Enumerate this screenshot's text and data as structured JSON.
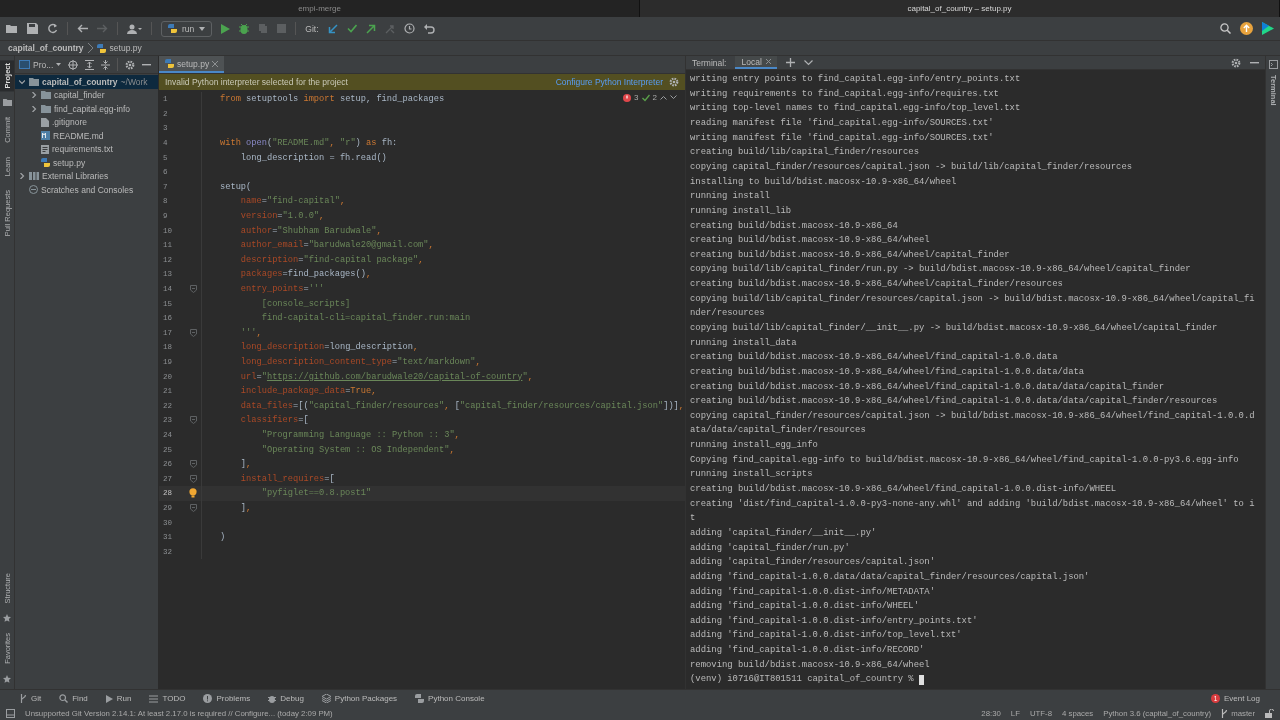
{
  "title_bar": {
    "tabs": [
      {
        "title": "empi-merge",
        "selected": false
      },
      {
        "title": "capital_of_country – setup.py",
        "selected": true
      }
    ]
  },
  "toolbar": {
    "left": [
      {
        "kind": "open",
        "disabled": false
      },
      {
        "kind": "save",
        "disabled": false
      },
      {
        "kind": "sync",
        "disabled": false
      },
      {
        "kind": "back",
        "disabled": false
      },
      {
        "kind": "forward",
        "disabled": true
      },
      {
        "kind": "user",
        "disabled": false
      }
    ],
    "run_config": "run",
    "run_actions": [
      {
        "kind": "play",
        "disabled": false
      },
      {
        "kind": "debug",
        "disabled": false
      },
      {
        "kind": "coverage",
        "disabled": true
      },
      {
        "kind": "stop",
        "disabled": true
      }
    ],
    "git_label": "Git:",
    "git_actions": [
      {
        "kind": "update",
        "disabled": false
      },
      {
        "kind": "commit",
        "disabled": false
      },
      {
        "kind": "push",
        "disabled": false
      },
      {
        "kind": "merge",
        "disabled": true
      },
      {
        "kind": "history",
        "disabled": false
      },
      {
        "kind": "rollback",
        "disabled": false
      }
    ]
  },
  "breadcrumb": [
    "capital_of_country",
    "setup.py"
  ],
  "left_strip": {
    "top": [
      {
        "label": "Project",
        "selected": true
      },
      {
        "label": "Commit",
        "selected": false
      },
      {
        "label": "Learn",
        "selected": false
      },
      {
        "label": "Pull Requests",
        "selected": false
      }
    ],
    "bottom": [
      {
        "label": "Structure",
        "selected": false
      },
      {
        "label": "Favorites",
        "selected": false
      }
    ]
  },
  "project": {
    "title": "Pro...",
    "tree": [
      {
        "name": "capital_of_country",
        "note": "~/Work",
        "kind": "folder",
        "expanded": true,
        "selected": true,
        "children": [
          {
            "name": "capital_finder",
            "kind": "folder",
            "expanded": false,
            "selected": false
          },
          {
            "name": "find_capital.egg-info",
            "kind": "folder",
            "expanded": false,
            "selected": false
          },
          {
            "name": ".gitignore",
            "kind": "file",
            "selected": false
          },
          {
            "name": "README.md",
            "kind": "markdown",
            "selected": false
          },
          {
            "name": "requirements.txt",
            "kind": "text",
            "selected": false
          },
          {
            "name": "setup.py",
            "kind": "python",
            "selected": false
          }
        ]
      },
      {
        "name": "External Libraries",
        "kind": "library",
        "expanded": false,
        "selected": false
      },
      {
        "name": "Scratches and Consoles",
        "kind": "scratch",
        "selected": false
      }
    ]
  },
  "editor": {
    "tab": "setup.py",
    "banner": {
      "message": "Invalid Python interpreter selected for the project",
      "link": "Configure Python Interpreter"
    },
    "errors": "3",
    "warnings": "2",
    "lines": [
      {
        "number": "1",
        "tokens": [
          {
            "kind": "kw",
            "text": "from"
          },
          {
            "kind": "plain",
            "text": " setuptools "
          },
          {
            "kind": "kw",
            "text": "import"
          },
          {
            "kind": "plain",
            "text": " setup, find_packages"
          }
        ]
      },
      {
        "number": "2"
      },
      {
        "number": "3"
      },
      {
        "number": "4",
        "tokens": [
          {
            "kind": "kw",
            "text": "with "
          },
          {
            "kind": "builtin",
            "text": "open"
          },
          {
            "kind": "plain",
            "text": "("
          },
          {
            "kind": "str",
            "text": "\"README.md\""
          },
          {
            "kind": "kw",
            "text": ", "
          },
          {
            "kind": "str",
            "text": "\"r\""
          },
          {
            "kind": "plain",
            "text": ") "
          },
          {
            "kind": "kw",
            "text": "as"
          },
          {
            "kind": "plain",
            "text": " fh:"
          }
        ]
      },
      {
        "number": "5",
        "tokens": [
          {
            "kind": "plain",
            "text": "    long_description = fh.read()"
          }
        ]
      },
      {
        "number": "6"
      },
      {
        "number": "7",
        "tokens": [
          {
            "kind": "plain",
            "text": "setup("
          }
        ]
      },
      {
        "number": "8",
        "tokens": [
          {
            "kind": "param",
            "text": "    name"
          },
          {
            "kind": "plain",
            "text": "="
          },
          {
            "kind": "str",
            "text": "\"find-capital\""
          },
          {
            "kind": "kw",
            "text": ","
          }
        ]
      },
      {
        "number": "9",
        "tokens": [
          {
            "kind": "param",
            "text": "    version"
          },
          {
            "kind": "plain",
            "text": "="
          },
          {
            "kind": "str",
            "text": "\"1.0.0\""
          },
          {
            "kind": "kw",
            "text": ","
          }
        ]
      },
      {
        "number": "10",
        "tokens": [
          {
            "kind": "param",
            "text": "    author"
          },
          {
            "kind": "plain",
            "text": "="
          },
          {
            "kind": "str",
            "text": "\"Shubham Barudwale\""
          },
          {
            "kind": "kw",
            "text": ","
          }
        ]
      },
      {
        "number": "11",
        "tokens": [
          {
            "kind": "param",
            "text": "    author_email"
          },
          {
            "kind": "plain",
            "text": "="
          },
          {
            "kind": "str",
            "text": "\"barudwale20@gmail.com\""
          },
          {
            "kind": "kw",
            "text": ","
          }
        ]
      },
      {
        "number": "12",
        "tokens": [
          {
            "kind": "param",
            "text": "    description"
          },
          {
            "kind": "plain",
            "text": "="
          },
          {
            "kind": "str",
            "text": "\"find-capital package\""
          },
          {
            "kind": "kw",
            "text": ","
          }
        ]
      },
      {
        "number": "13",
        "tokens": [
          {
            "kind": "param",
            "text": "    packages"
          },
          {
            "kind": "plain",
            "text": "=find_packages()"
          },
          {
            "kind": "kw",
            "text": ","
          }
        ]
      },
      {
        "number": "14",
        "fold": true,
        "tokens": [
          {
            "kind": "param",
            "text": "    entry_points"
          },
          {
            "kind": "plain",
            "text": "="
          },
          {
            "kind": "str",
            "text": "'''"
          }
        ]
      },
      {
        "number": "15",
        "tokens": [
          {
            "kind": "str",
            "text": "        [console_scripts]"
          }
        ]
      },
      {
        "number": "16",
        "tokens": [
          {
            "kind": "str",
            "text": "        find-capital-cli=capital_finder.run:main"
          }
        ]
      },
      {
        "number": "17",
        "fold": true,
        "tokens": [
          {
            "kind": "str",
            "text": "    '''"
          },
          {
            "kind": "kw",
            "text": ","
          }
        ]
      },
      {
        "number": "18",
        "tokens": [
          {
            "kind": "param",
            "text": "    long_description"
          },
          {
            "kind": "plain",
            "text": "=long_description"
          },
          {
            "kind": "kw",
            "text": ","
          }
        ]
      },
      {
        "number": "19",
        "tokens": [
          {
            "kind": "param",
            "text": "    long_description_content_type"
          },
          {
            "kind": "plain",
            "text": "="
          },
          {
            "kind": "str",
            "text": "\"text/markdown\""
          },
          {
            "kind": "kw",
            "text": ","
          }
        ]
      },
      {
        "number": "20",
        "tokens": [
          {
            "kind": "param",
            "text": "    url"
          },
          {
            "kind": "plain",
            "text": "="
          },
          {
            "kind": "str",
            "text": "\""
          },
          {
            "kind": "link",
            "text": "https://github.com/barudwale20/capital-of-country"
          },
          {
            "kind": "str",
            "text": "\""
          },
          {
            "kind": "kw",
            "text": ","
          }
        ]
      },
      {
        "number": "21",
        "tokens": [
          {
            "kind": "param",
            "text": "    include_package_data"
          },
          {
            "kind": "plain",
            "text": "="
          },
          {
            "kind": "kw",
            "text": "True,"
          }
        ]
      },
      {
        "number": "22",
        "tokens": [
          {
            "kind": "param",
            "text": "    data_files"
          },
          {
            "kind": "plain",
            "text": "=[("
          },
          {
            "kind": "str",
            "text": "\"capital_finder/resources\""
          },
          {
            "kind": "kw",
            "text": ", "
          },
          {
            "kind": "plain",
            "text": "["
          },
          {
            "kind": "str",
            "text": "\"capital_finder/resources/capital.json\""
          },
          {
            "kind": "plain",
            "text": "])]"
          },
          {
            "kind": "kw",
            "text": ","
          }
        ]
      },
      {
        "number": "23",
        "fold": true,
        "tokens": [
          {
            "kind": "param",
            "text": "    classifiers"
          },
          {
            "kind": "plain",
            "text": "=["
          }
        ]
      },
      {
        "number": "24",
        "tokens": [
          {
            "kind": "str",
            "text": "        \"Programming Language :: Python :: 3\""
          },
          {
            "kind": "kw",
            "text": ","
          }
        ]
      },
      {
        "number": "25",
        "tokens": [
          {
            "kind": "str",
            "text": "        \"Operating System :: OS Independent\""
          },
          {
            "kind": "kw",
            "text": ","
          }
        ]
      },
      {
        "number": "26",
        "fold": true,
        "tokens": [
          {
            "kind": "plain",
            "text": "    ]"
          },
          {
            "kind": "kw",
            "text": ","
          }
        ]
      },
      {
        "number": "27",
        "fold": true,
        "tokens": [
          {
            "kind": "param",
            "text": "    install_requires"
          },
          {
            "kind": "plain",
            "text": "=["
          }
        ]
      },
      {
        "number": "28",
        "current": true,
        "bulb": true,
        "tokens": [
          {
            "kind": "str",
            "text": "        \"pyfiglet==0.8.post1\""
          }
        ]
      },
      {
        "number": "29",
        "fold": true,
        "tokens": [
          {
            "kind": "plain",
            "text": "    ]"
          },
          {
            "kind": "kw",
            "text": ","
          }
        ]
      },
      {
        "number": "30"
      },
      {
        "number": "31",
        "tokens": [
          {
            "kind": "plain",
            "text": ")"
          }
        ]
      },
      {
        "number": "32"
      }
    ]
  },
  "terminal": {
    "label": "Terminal:",
    "tabs": [
      {
        "label": "Local",
        "selected": true
      }
    ],
    "lines": [
      "writing entry points to find_capital.egg-info/entry_points.txt",
      "writing requirements to find_capital.egg-info/requires.txt",
      "writing top-level names to find_capital.egg-info/top_level.txt",
      "reading manifest file 'find_capital.egg-info/SOURCES.txt'",
      "writing manifest file 'find_capital.egg-info/SOURCES.txt'",
      "creating build/lib/capital_finder/resources",
      "copying capital_finder/resources/capital.json -> build/lib/capital_finder/resources",
      "installing to build/bdist.macosx-10.9-x86_64/wheel",
      "running install",
      "running install_lib",
      "creating build/bdist.macosx-10.9-x86_64",
      "creating build/bdist.macosx-10.9-x86_64/wheel",
      "creating build/bdist.macosx-10.9-x86_64/wheel/capital_finder",
      "copying build/lib/capital_finder/run.py -> build/bdist.macosx-10.9-x86_64/wheel/capital_finder",
      "creating build/bdist.macosx-10.9-x86_64/wheel/capital_finder/resources",
      "copying build/lib/capital_finder/resources/capital.json -> build/bdist.macosx-10.9-x86_64/wheel/capital_fi",
      "nder/resources",
      "copying build/lib/capital_finder/__init__.py -> build/bdist.macosx-10.9-x86_64/wheel/capital_finder",
      "running install_data",
      "creating build/bdist.macosx-10.9-x86_64/wheel/find_capital-1.0.0.data",
      "creating build/bdist.macosx-10.9-x86_64/wheel/find_capital-1.0.0.data/data",
      "creating build/bdist.macosx-10.9-x86_64/wheel/find_capital-1.0.0.data/data/capital_finder",
      "creating build/bdist.macosx-10.9-x86_64/wheel/find_capital-1.0.0.data/data/capital_finder/resources",
      "copying capital_finder/resources/capital.json -> build/bdist.macosx-10.9-x86_64/wheel/find_capital-1.0.0.d",
      "ata/data/capital_finder/resources",
      "running install_egg_info",
      "Copying find_capital.egg-info to build/bdist.macosx-10.9-x86_64/wheel/find_capital-1.0.0-py3.6.egg-info",
      "running install_scripts",
      "creating build/bdist.macosx-10.9-x86_64/wheel/find_capital-1.0.0.dist-info/WHEEL",
      "creating 'dist/find_capital-1.0.0-py3-none-any.whl' and adding 'build/bdist.macosx-10.9-x86_64/wheel' to i",
      "t",
      "adding 'capital_finder/__init__.py'",
      "adding 'capital_finder/run.py'",
      "adding 'capital_finder/resources/capital.json'",
      "adding 'find_capital-1.0.0.data/data/capital_finder/resources/capital.json'",
      "adding 'find_capital-1.0.0.dist-info/METADATA'",
      "adding 'find_capital-1.0.0.dist-info/WHEEL'",
      "adding 'find_capital-1.0.0.dist-info/entry_points.txt'",
      "adding 'find_capital-1.0.0.dist-info/top_level.txt'",
      "adding 'find_capital-1.0.0.dist-info/RECORD'",
      "removing build/bdist.macosx-10.9-x86_64/wheel"
    ],
    "prompt": "(venv) i0716@IT801511 capital_of_country %"
  },
  "right_strip": {
    "label": "Terminal"
  },
  "tool_windows": [
    {
      "kind": "git",
      "label": "Git"
    },
    {
      "kind": "find",
      "label": "Find"
    },
    {
      "kind": "run",
      "label": "Run"
    },
    {
      "kind": "todo",
      "label": "TODO"
    },
    {
      "kind": "problems",
      "label": "Problems"
    },
    {
      "kind": "debug",
      "label": "Debug"
    },
    {
      "kind": "packages",
      "label": "Python Packages"
    },
    {
      "kind": "console",
      "label": "Python Console"
    }
  ],
  "event_log": {
    "label": "Event Log",
    "count": "1"
  },
  "status_bar": {
    "message": "Unsupported Git Version 2.14.1: At least 2.17.0 is required // Configure... (today 2:09 PM)",
    "items": [
      "28:30",
      "LF",
      "UTF-8",
      "4 spaces",
      "Python 3.6 (capital_of_country)"
    ],
    "branch": "master"
  }
}
